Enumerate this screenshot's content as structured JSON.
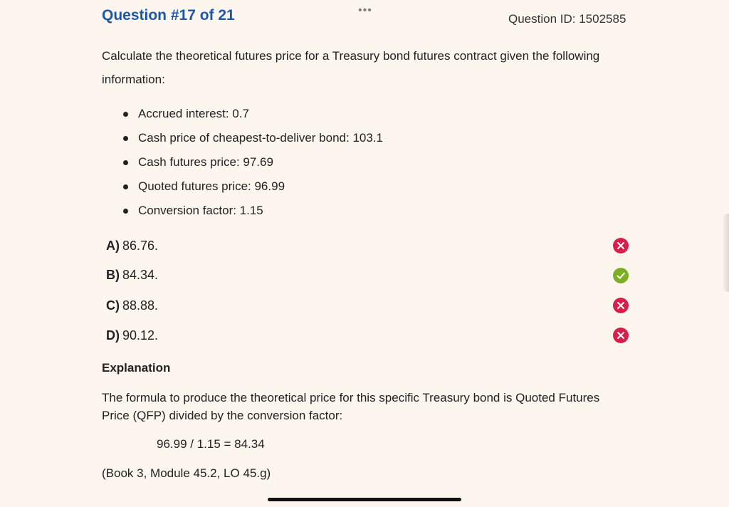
{
  "header": {
    "more_menu": "•••",
    "question_title": "Question #17 of 21",
    "question_id": "Question ID: 1502585"
  },
  "question": {
    "stem": "Calculate the theoretical futures price for a Treasury bond futures contract given the following information:",
    "facts": [
      "Accrued interest: 0.7",
      "Cash price of cheapest-to-deliver bond: 103.1",
      "Cash futures price: 97.69",
      "Quoted futures price: 96.99",
      "Conversion factor: 1.15"
    ]
  },
  "choices": [
    {
      "letter": "A)",
      "text": "86.76.",
      "status": "incorrect",
      "status_icon": "x-circle-icon"
    },
    {
      "letter": "B)",
      "text": "84.34.",
      "status": "correct",
      "status_icon": "check-circle-icon"
    },
    {
      "letter": "C)",
      "text": "88.88.",
      "status": "incorrect",
      "status_icon": "x-circle-icon"
    },
    {
      "letter": "D)",
      "text": "90.12.",
      "status": "incorrect",
      "status_icon": "x-circle-icon"
    }
  ],
  "explanation": {
    "heading": "Explanation",
    "text": "The formula to produce the theoretical price for this specific Treasury bond is Quoted Futures Price (QFP) divided by the conversion factor:",
    "formula": "96.99 / 1.15 = 84.34",
    "reference": "(Book 3, Module 45.2, LO 45.g)"
  },
  "colors": {
    "background": "#fcf6ee",
    "title": "#1b57a8",
    "correct": "#7bb026",
    "incorrect": "#d81e4a"
  }
}
